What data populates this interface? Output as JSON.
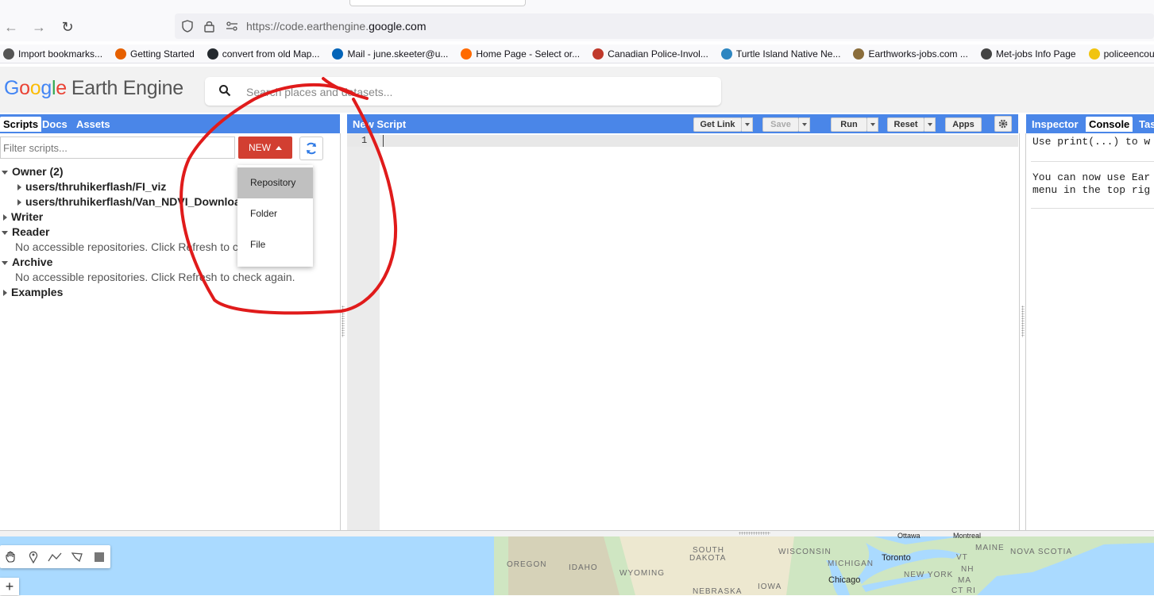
{
  "browser": {
    "url_prefix": "https://code.earthengine.",
    "url_domain": "google.com",
    "bookmarks": [
      {
        "label": "Import bookmarks...",
        "color": "#555"
      },
      {
        "label": "Getting Started",
        "color": "#e66000"
      },
      {
        "label": "convert from old Map...",
        "color": "#24292e"
      },
      {
        "label": "Mail - june.skeeter@u...",
        "color": "#0364b8"
      },
      {
        "label": "Home Page - Select or...",
        "color": "#ff6a00"
      },
      {
        "label": "Canadian Police-Invol...",
        "color": "#c0392b"
      },
      {
        "label": "Turtle Island Native Ne...",
        "color": "#2e86c1"
      },
      {
        "label": "Earthworks-jobs.com ...",
        "color": "#8a6d3b"
      },
      {
        "label": "Met-jobs Info Page",
        "color": "#444"
      },
      {
        "label": "policeencounters",
        "color": "#f1c40f"
      }
    ]
  },
  "header": {
    "logo_google": [
      "G",
      "o",
      "o",
      "g",
      "l",
      "e"
    ],
    "logo_product": "Earth Engine",
    "search_placeholder": "Search places and datasets..."
  },
  "left": {
    "tabs": [
      "Scripts",
      "Docs",
      "Assets"
    ],
    "filter_placeholder": "Filter scripts...",
    "new_button": "NEW",
    "tree": {
      "owner": "Owner (2)",
      "repo1": "users/thruhikerflash/FI_viz",
      "repo2": "users/thruhikerflash/Van_NDVI_Download",
      "writer": "Writer",
      "reader": "Reader",
      "reader_msg": "No accessible repositories. Click Refresh to c",
      "archive": "Archive",
      "archive_msg": "No accessible repositories. Click Refresh to check again.",
      "examples": "Examples"
    },
    "dropdown": [
      "Repository",
      "Folder",
      "File"
    ]
  },
  "editor": {
    "title": "New Script",
    "buttons": {
      "get_link": "Get Link",
      "save": "Save",
      "run": "Run",
      "reset": "Reset",
      "apps": "Apps"
    },
    "line_number": "1"
  },
  "right": {
    "tabs": [
      "Inspector",
      "Console",
      "Tas"
    ],
    "console_line1": "Use print(...) to w",
    "console_line2": "You can now use Ear",
    "console_line3": "menu in the top rig"
  },
  "map": {
    "labels": [
      "OREGON",
      "IDAHO",
      "WYOMING",
      "SOUTH",
      "DAKOTA",
      "NEBRASKA",
      "IOWA",
      "WISCONSIN",
      "MICHIGAN",
      "MAINE",
      "NOVA SCOTIA",
      "VT",
      "NH",
      "MA",
      "CT RI",
      "NEW YORK"
    ],
    "cities": [
      "Toronto",
      "Chicago",
      "Ottawa",
      "Montreal"
    ]
  },
  "colors": {
    "panel_blue": "#4a86e8",
    "new_red": "#d23f31",
    "annotation_red": "#e01b1b"
  }
}
